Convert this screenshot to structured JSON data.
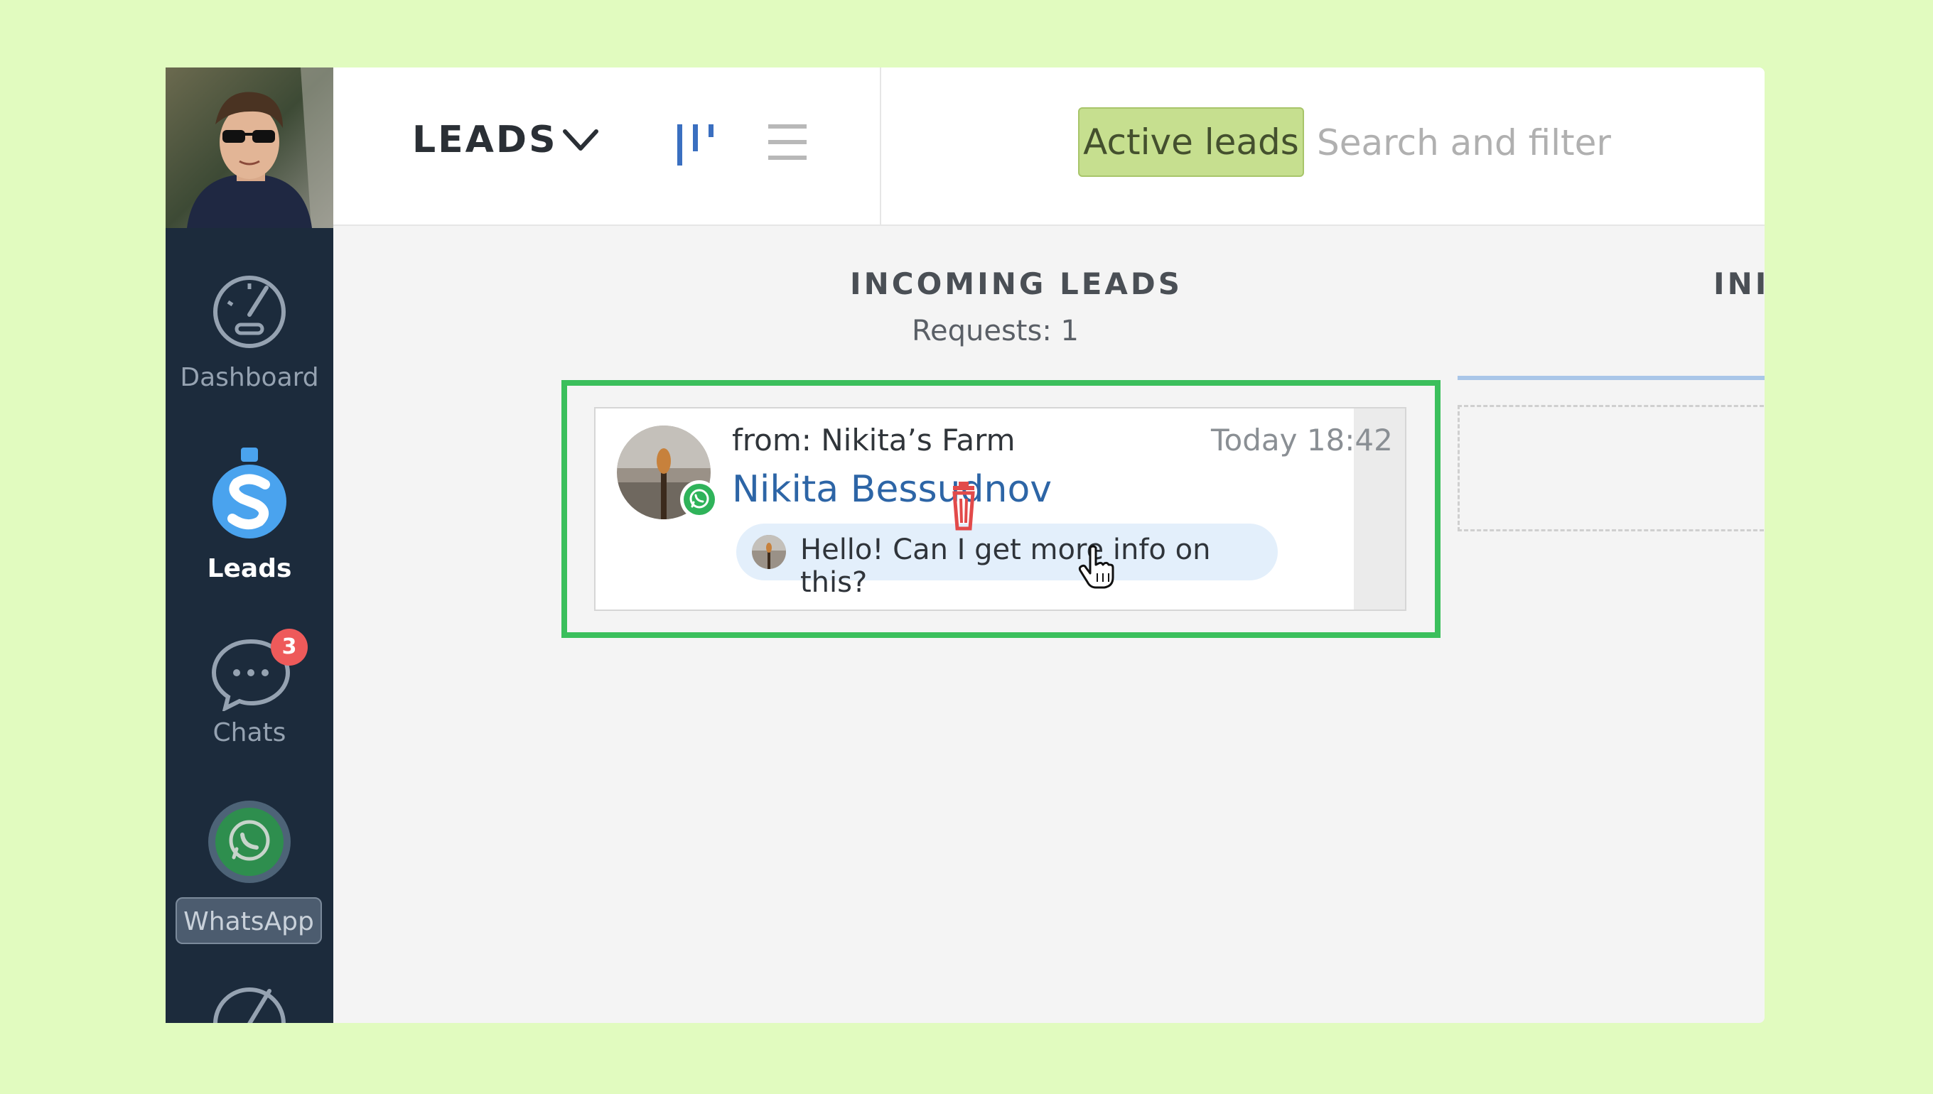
{
  "sidebar": {
    "items": [
      {
        "label": "Dashboard",
        "icon": "speedometer-icon"
      },
      {
        "label": "Leads",
        "icon": "leads-s-icon",
        "active": true
      },
      {
        "label": "Chats",
        "icon": "chat-bubble-icon",
        "badge": "3"
      },
      {
        "label": "WhatsApp",
        "icon": "whatsapp-icon"
      }
    ]
  },
  "header": {
    "title": "LEADS",
    "filter_chip": "Active leads",
    "search_placeholder": "Search and filter"
  },
  "board": {
    "columns": [
      {
        "title": "INCOMING LEADS",
        "subtitle": "Requests: 1"
      },
      {
        "title": "INI"
      }
    ]
  },
  "lead_card": {
    "from": "from: Nikita’s Farm",
    "time": "Today 18:42",
    "name": "Nikita Bessudnov",
    "message": "Hello! Can I get more info on this?",
    "channel": "whatsapp-icon"
  },
  "colors": {
    "background": "#e1fbbf",
    "sidebar": "#1c2b3c",
    "highlight": "#3bbf5c",
    "chip": "#c6df8f",
    "link": "#2d65a6",
    "badge": "#ee5a5a"
  }
}
